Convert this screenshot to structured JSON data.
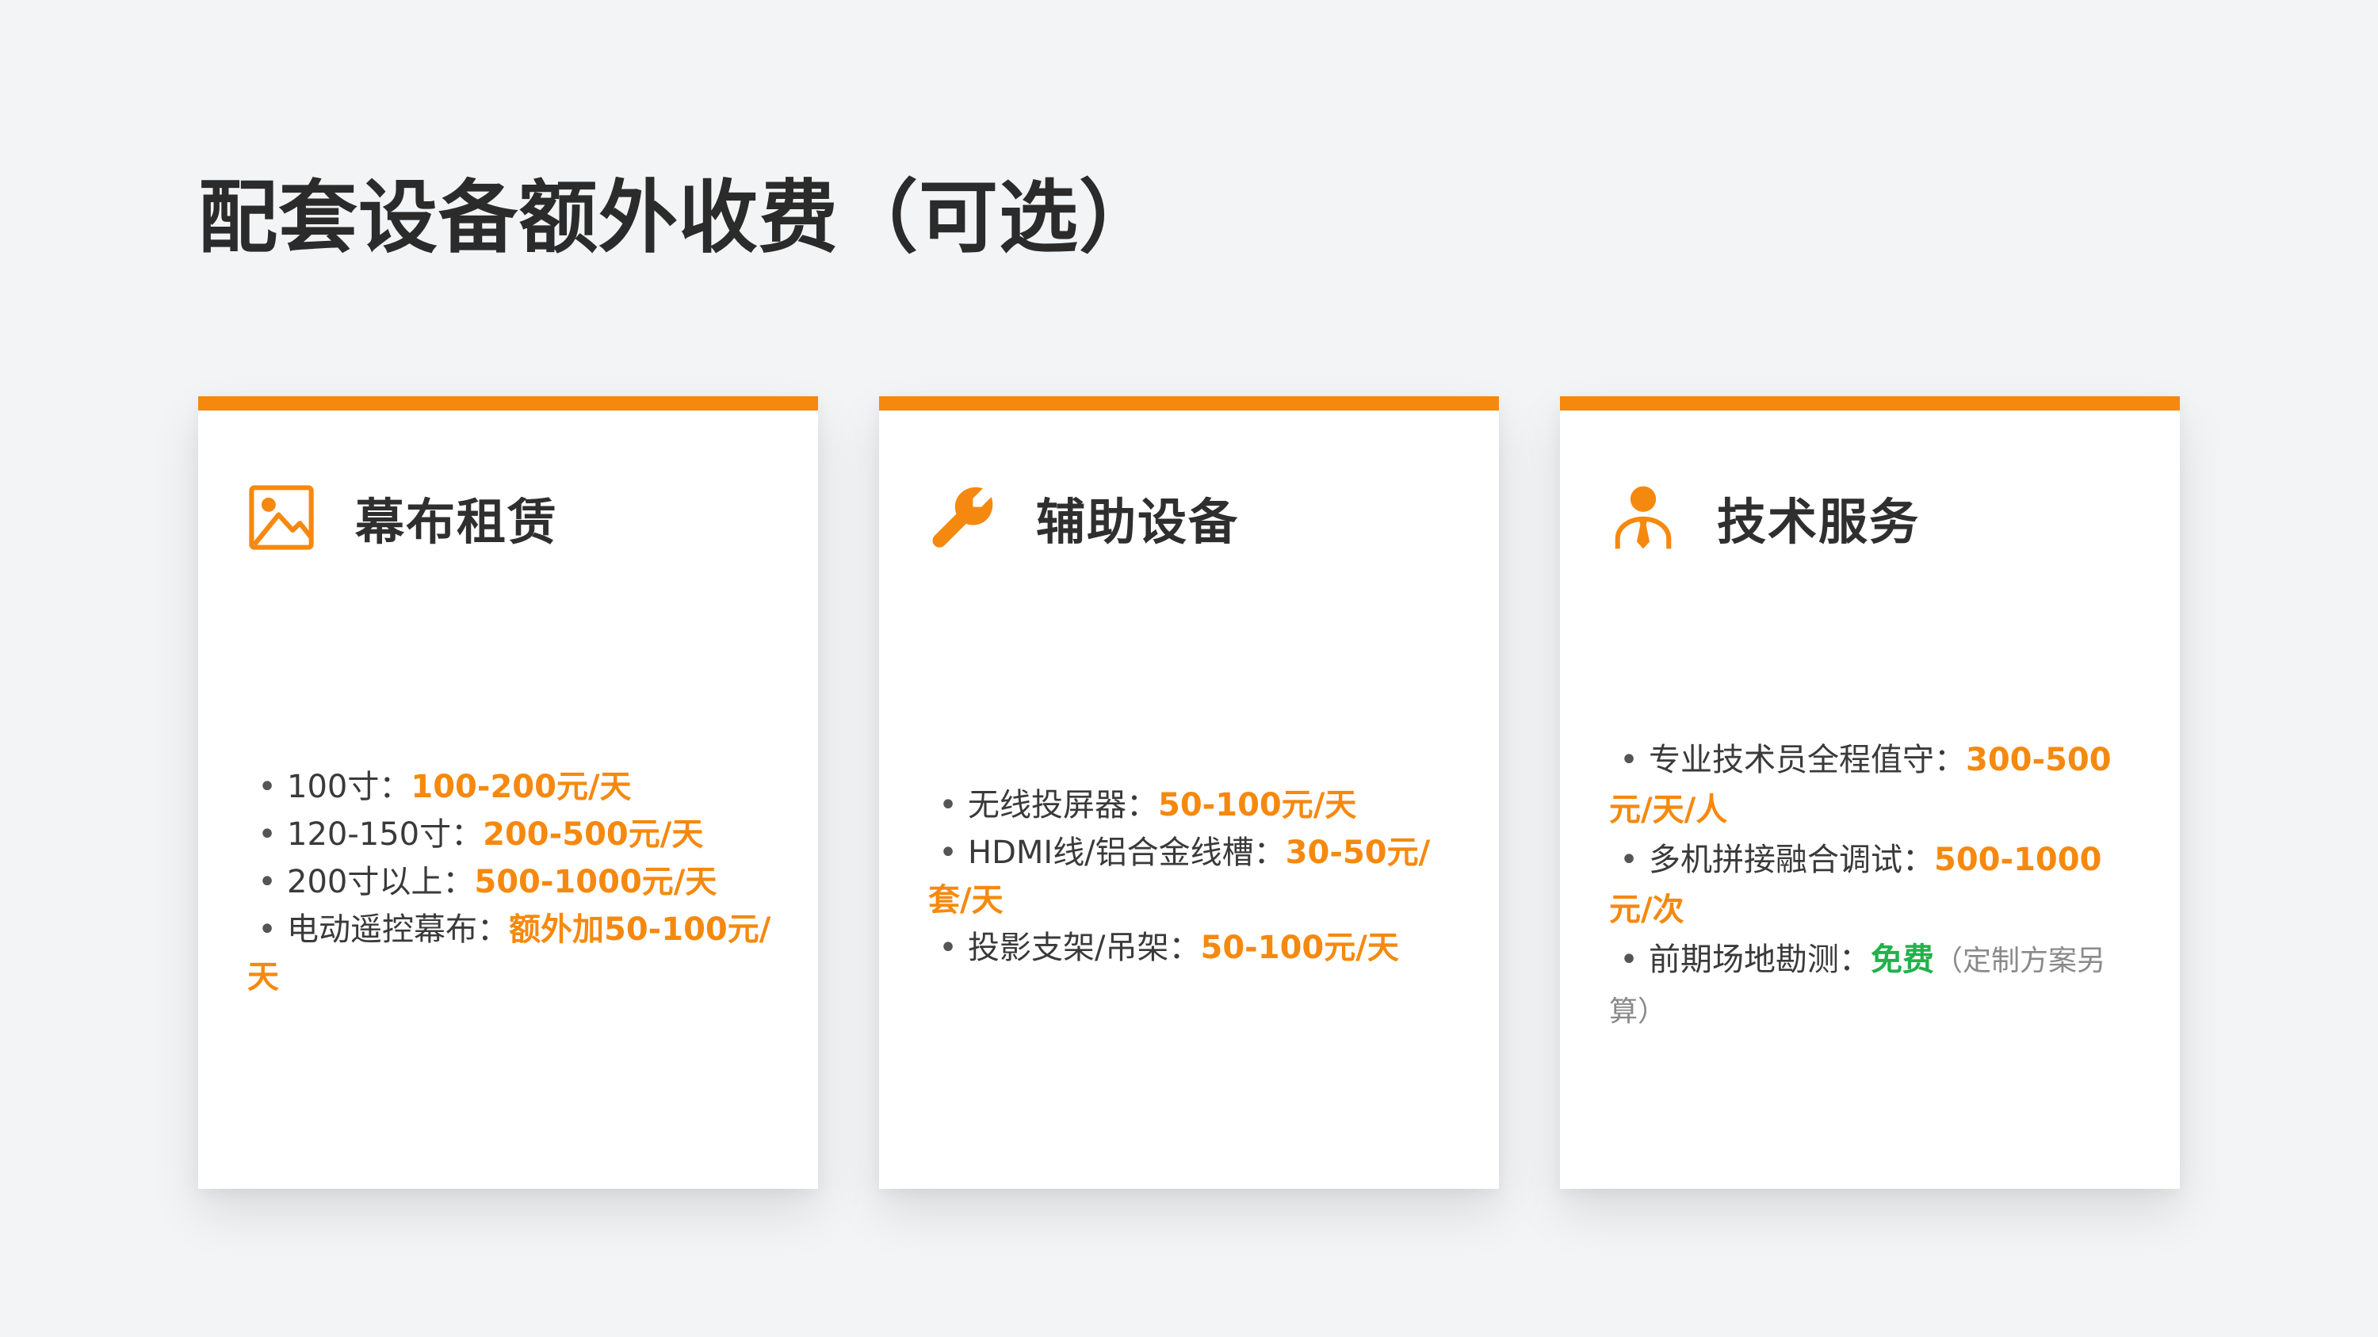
{
  "page": {
    "title": "配套设备额外收费（可选）"
  },
  "colors": {
    "accent": "#f5890f",
    "free": "#22b14c",
    "background": "#f3f4f6",
    "card": "#ffffff",
    "title_text": "#2b2b2b",
    "note_text": "#8a8a8a"
  },
  "cards": [
    {
      "icon": "image-icon",
      "title": "幕布租赁",
      "items": [
        {
          "bullet": "•",
          "label": "100寸：",
          "price": "100-200元/天"
        },
        {
          "bullet": "•",
          "label": "120-150寸：",
          "price": "200-500元/天"
        },
        {
          "bullet": "•",
          "label": "200寸以上：",
          "price": "500-1000元/天"
        },
        {
          "bullet": "•",
          "label": "电动遥控幕布：",
          "price": "额外加50-100元/天"
        }
      ]
    },
    {
      "icon": "wrench-icon",
      "title": "辅助设备",
      "items": [
        {
          "bullet": "•",
          "label": "无线投屏器：",
          "price": "50-100元/天"
        },
        {
          "bullet": "•",
          "label": "HDMI线/铝合金线槽：",
          "price": "30-50元/套/天"
        },
        {
          "bullet": "•",
          "label": "投影支架/吊架：",
          "price": "50-100元/天"
        }
      ]
    },
    {
      "icon": "technician-icon",
      "title": "技术服务",
      "items": [
        {
          "bullet": "•",
          "label": "专业技术员全程值守：",
          "price": "300-500元/天/人"
        },
        {
          "bullet": "•",
          "label": "多机拼接融合调试：",
          "price": "500-1000元/次"
        },
        {
          "bullet": "•",
          "label": "前期场地勘测：",
          "price": "免费",
          "note": "（定制方案另算）"
        }
      ]
    }
  ]
}
